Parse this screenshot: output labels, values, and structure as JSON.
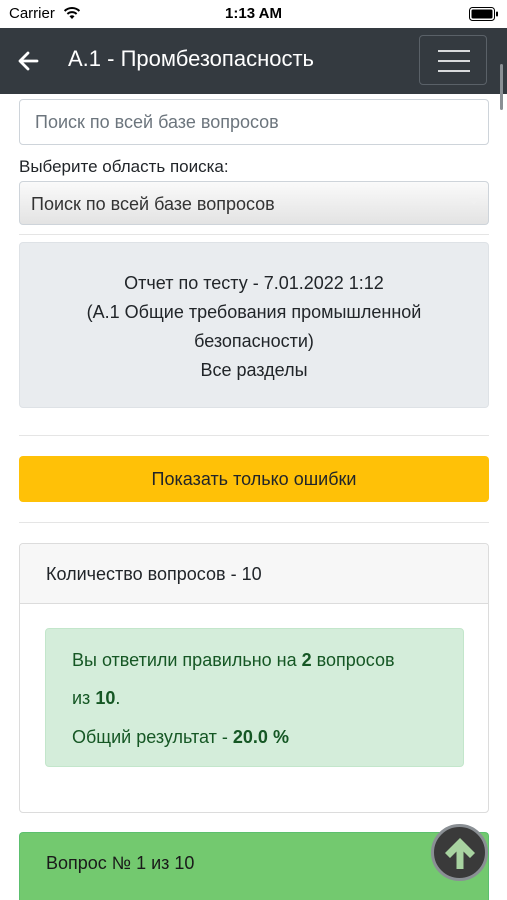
{
  "status_bar": {
    "carrier": "Carrier",
    "time": "1:13 AM"
  },
  "nav": {
    "title": "А.1 - Промбезопасность",
    "back_icon": "back-arrow-icon",
    "menu_icon": "hamburger-menu-icon"
  },
  "search": {
    "placeholder": "Поиск по всей базе вопросов",
    "area_label": "Выберите область поиска:",
    "area_selected": "Поиск по всей базе вопросов"
  },
  "report": {
    "line1": "Отчет по тесту - 7.01.2022 1:12",
    "line2": "(А.1 Общие требования промышленной",
    "line3": "безопасности)",
    "line4": "Все разделы"
  },
  "errors_button": {
    "label": "Показать только ошибки",
    "color": "#ffc107"
  },
  "results": {
    "header": "Количество вопросов - 10",
    "answered_prefix": "Вы ответили правильно на",
    "correct_count": "2",
    "answered_suffix": "вопросов",
    "of_prefix": "из",
    "total_count": "10",
    "of_suffix": ".",
    "score_label": "Общий результат -",
    "score_value": "20.0 %",
    "alert_color": "#d4edda"
  },
  "question": {
    "header": "Вопрос № 1 из 10",
    "header_color": "#73c96f"
  },
  "scroll_top_icon": "arrow-up-icon"
}
